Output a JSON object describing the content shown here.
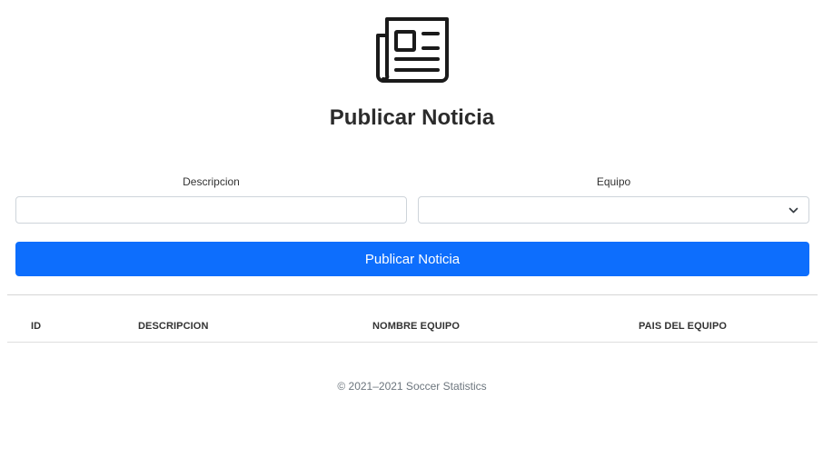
{
  "header": {
    "icon": "newspaper-icon",
    "title": "Publicar Noticia"
  },
  "form": {
    "descripcion_label": "Descripcion",
    "descripcion_value": "",
    "descripcion_placeholder": "",
    "equipo_label": "Equipo",
    "equipo_selected": "",
    "submit_label": "Publicar Noticia",
    "accent_color": "#0d6efd"
  },
  "table": {
    "columns": [
      "ID",
      "DESCRIPCION",
      "NOMBRE EQUIPO",
      "PAIS DEL EQUIPO"
    ],
    "rows": []
  },
  "footer": {
    "text": "© 2021–2021 Soccer Statistics"
  }
}
